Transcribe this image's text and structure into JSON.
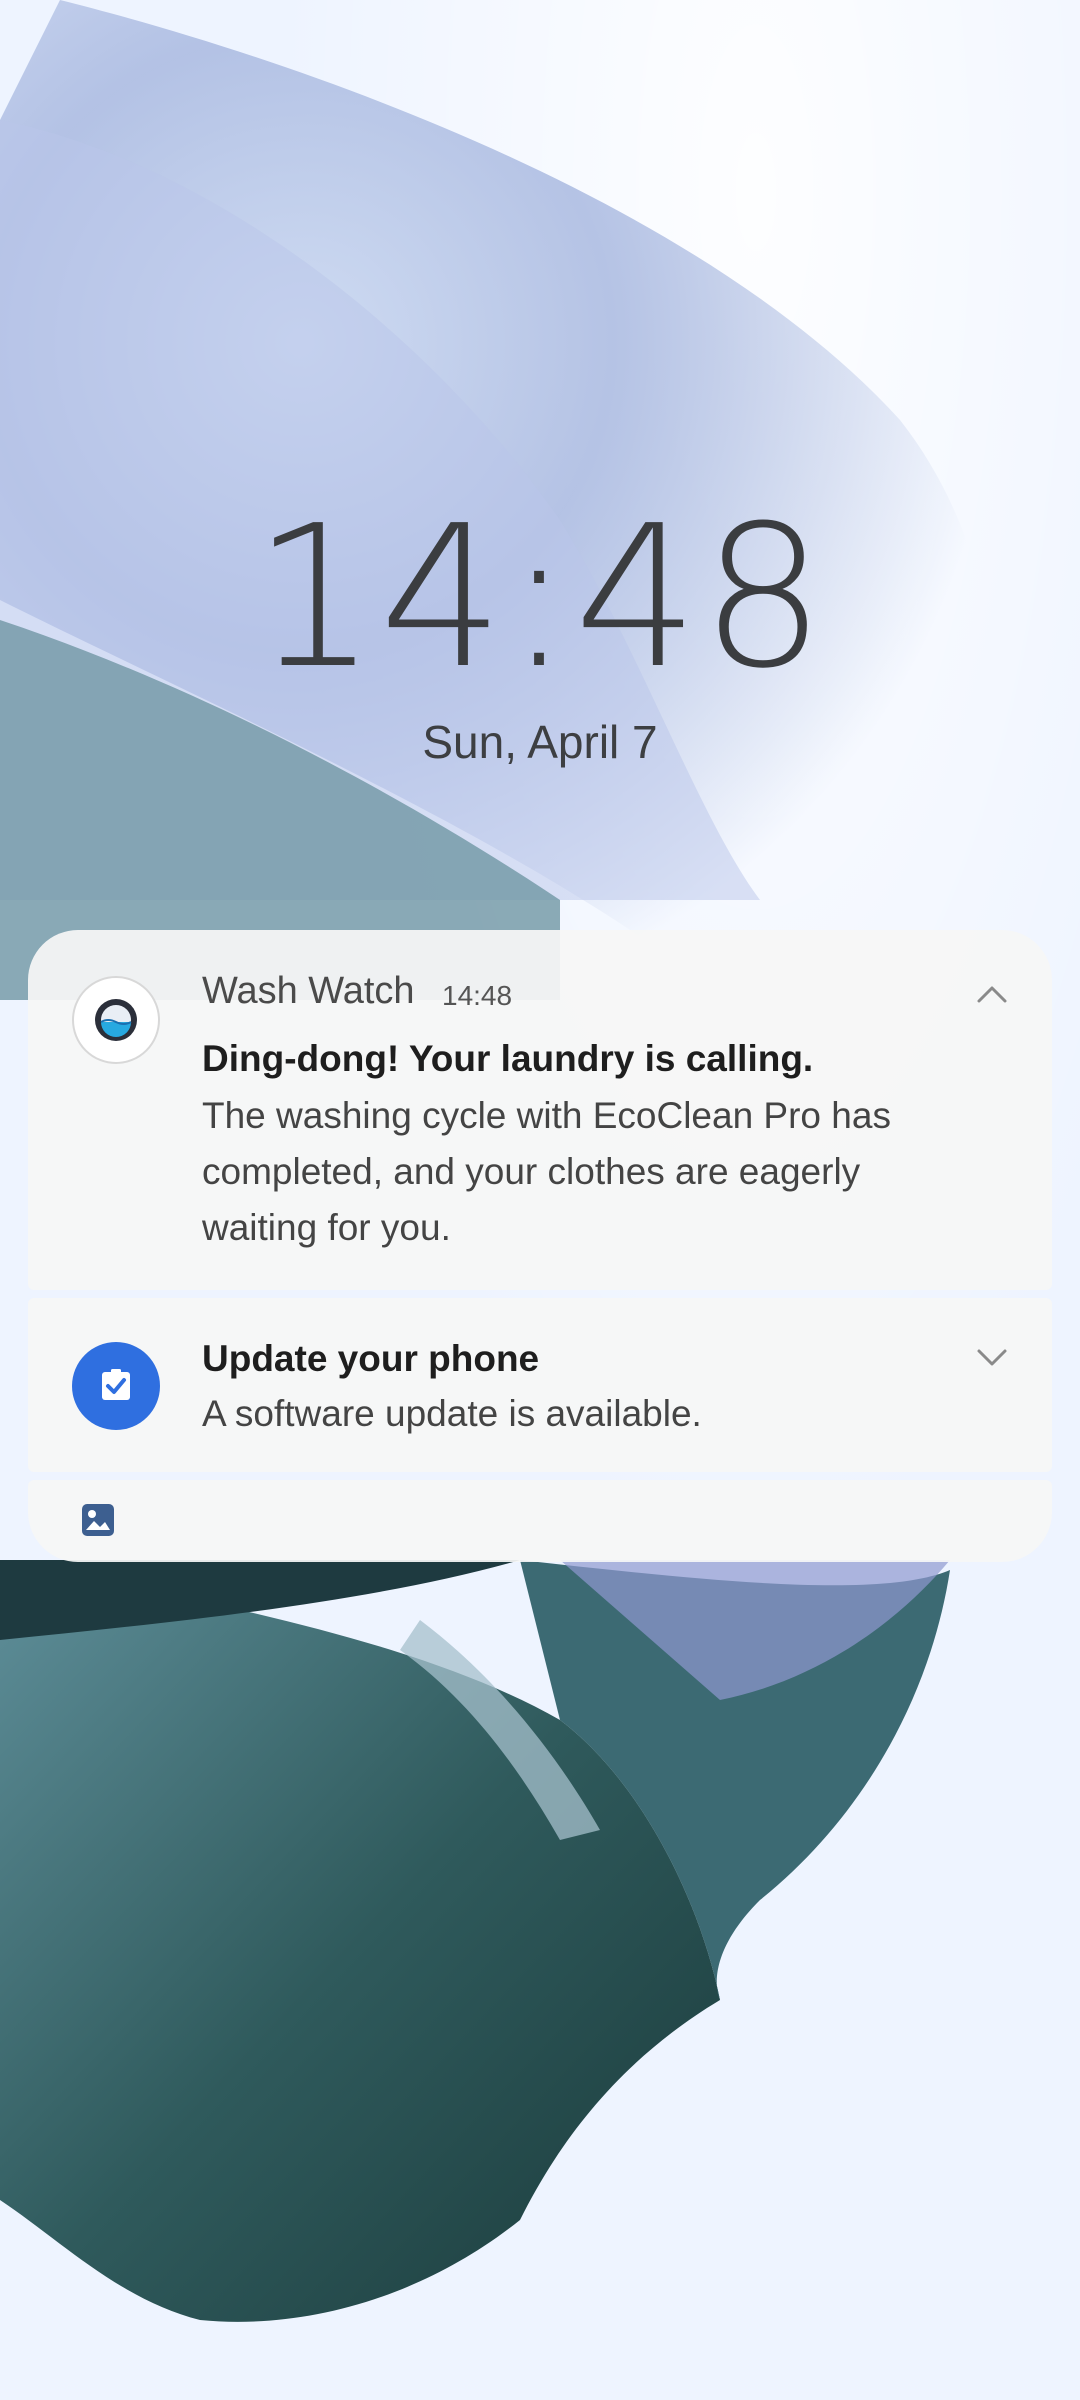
{
  "lockscreen": {
    "time": "14:48",
    "date": "Sun, April 7"
  },
  "notifications": [
    {
      "app_name": "Wash Watch",
      "time": "14:48",
      "title": "Ding-dong! Your laundry is calling.",
      "body": "The washing cycle with EcoClean Pro has completed, and your clothes are eagerly waiting for you.",
      "icon": "washing-machine-icon",
      "state": "expanded"
    },
    {
      "title": "Update your phone",
      "body": "A software update is available.",
      "icon": "software-update-icon",
      "state": "collapsed"
    },
    {
      "icon": "gallery-icon"
    }
  ],
  "colors": {
    "update_icon_bg": "#2f6fe0",
    "card_bg": "#f6f6f6",
    "wallpaper_bg": "#eef4ff"
  }
}
